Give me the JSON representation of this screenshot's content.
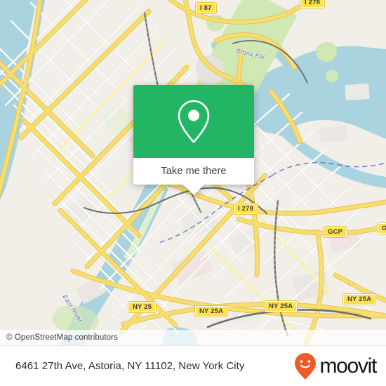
{
  "popup": {
    "action_label": "Take me there",
    "pin_icon": "map-pin-icon",
    "green_hex": "#22b563"
  },
  "map": {
    "attribution": "© OpenStreetMap contributors",
    "water_labels": [
      {
        "text": "Bronx Kill"
      },
      {
        "text": "East River"
      }
    ],
    "shields": [
      {
        "text": "I 87"
      },
      {
        "text": "I 278"
      },
      {
        "text": "I 278"
      },
      {
        "text": "GCP"
      },
      {
        "text": "GCP"
      },
      {
        "text": "NY 25"
      },
      {
        "text": "NY 25A"
      },
      {
        "text": "NY 25A"
      },
      {
        "text": "NY 25A"
      }
    ],
    "colors": {
      "land": "#f2efe9",
      "water": "#aad3e0",
      "park": "#cfe8b4",
      "motorway": "#f7de6e",
      "shield_fill": "#ffe14d"
    }
  },
  "bottom_bar": {
    "address": "6461 27th Ave, Astoria, NY 11102, New York City",
    "brand_name": "moovit",
    "brand_icon": "moovit-smiley-pin-icon",
    "brand_accent": "#ee5b26"
  }
}
